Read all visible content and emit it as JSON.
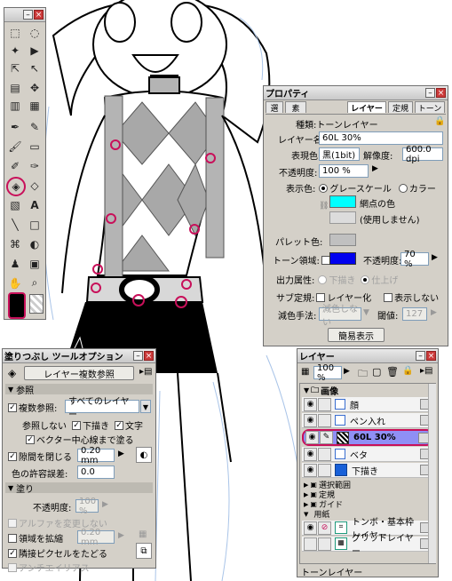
{
  "property_panel": {
    "title": "プロパティ",
    "tabs": [
      "選",
      "素",
      "レイヤー",
      "定規",
      "トーン"
    ],
    "kind_label": "種類:",
    "kind_value": "トーンレイヤー",
    "layer_name_label": "レイヤー名:",
    "layer_name_value": "60L 30%",
    "expression_label": "表現色:",
    "expression_value": "黒(1bit)",
    "resolution_label": "解像度:",
    "resolution_value": "600.0 dpi",
    "opacity_label": "不透明度:",
    "opacity_value": "100 %",
    "display_color_label": "表示色:",
    "grayscale_option": "グレースケール",
    "color_option": "カラー",
    "dot_color_label": "網点の色",
    "unused_label": "(使用しません)",
    "palette_label": "パレット色:",
    "tone_area_label": "トーン領域:",
    "tone_opacity_label": "不透明度:",
    "tone_opacity_value": "70 %",
    "output_label": "出力属性:",
    "output_draft": "下描き",
    "output_finish": "仕上げ",
    "sub_ruler_label": "サブ定規:",
    "layerize_label": "レイヤー化",
    "hide_label": "表示しない",
    "reduce_label": "減色手法:",
    "reduce_value": "減色しない",
    "threshold_label": "閾値:",
    "threshold_value": "127",
    "simple_button": "簡易表示",
    "accent_color": "#00ffff",
    "tone_area_color": "#0000ee"
  },
  "fill_panel": {
    "title": "塗りつぶし ツールオプション",
    "ref_button": "レイヤー複数参照",
    "section_ref": "参照",
    "multi_ref_label": "複数参照:",
    "multi_ref_value": "すべてのレイヤー",
    "no_ref_label": "参照しない",
    "no_ref_draft": "下描き",
    "no_ref_text": "文字",
    "vector_center_label": "ベクター中心線まで塗る",
    "close_gap_label": "隙間を閉じる",
    "close_gap_value": "0.20 mm",
    "tolerance_label": "色の許容誤差:",
    "tolerance_value": "0.0",
    "section_fill": "塗り",
    "opacity_label": "不透明度:",
    "opacity_value": "100 %",
    "alpha_label": "アルファを変更しない",
    "expand_label": "領域を拡縮",
    "expand_value": "0.20 mm",
    "adjacent_label": "隣接ピクセルをたどる",
    "antialias_label": "アンチエイリアス"
  },
  "layer_panel": {
    "title": "レイヤー",
    "zoom_value": "100 %",
    "folder_label": "画像",
    "layers": [
      {
        "name": "顔",
        "selected": false
      },
      {
        "name": "ペン入れ",
        "selected": false
      },
      {
        "name": "60L 30%",
        "selected": true
      },
      {
        "name": "ベタ",
        "selected": false
      },
      {
        "name": "下描き",
        "selected": false
      }
    ],
    "groups": [
      "選択範囲",
      "定規",
      "ガイド",
      "用紙"
    ],
    "paper_layers": [
      {
        "name": "トンボ・基本枠レイヤー"
      },
      {
        "name": "グリッドレイヤー"
      }
    ],
    "status": "トーンレイヤー",
    "selection_color": "#8f8ff5"
  },
  "toolbox": {
    "tools": [
      "selection-rect-icon",
      "lasso-icon",
      "magic-wand-icon",
      "move-icon",
      "object-select-icon",
      "hand-move-icon",
      "gradient-icon",
      "move-cross-icon",
      "ruler-icon",
      "grid-icon",
      "pen-icon",
      "pencil-icon",
      "brush-icon",
      "eraser-icon",
      "airbrush-icon",
      "dropper-icon",
      "fill-bucket-icon",
      "pattern-fill-icon",
      "gradient-tool-icon",
      "text-icon",
      "line-icon",
      "rect-icon",
      "vector-icon",
      "balloon-icon",
      "stamp-icon",
      "palette-icon",
      "hand-icon",
      "zoom-icon"
    ]
  }
}
